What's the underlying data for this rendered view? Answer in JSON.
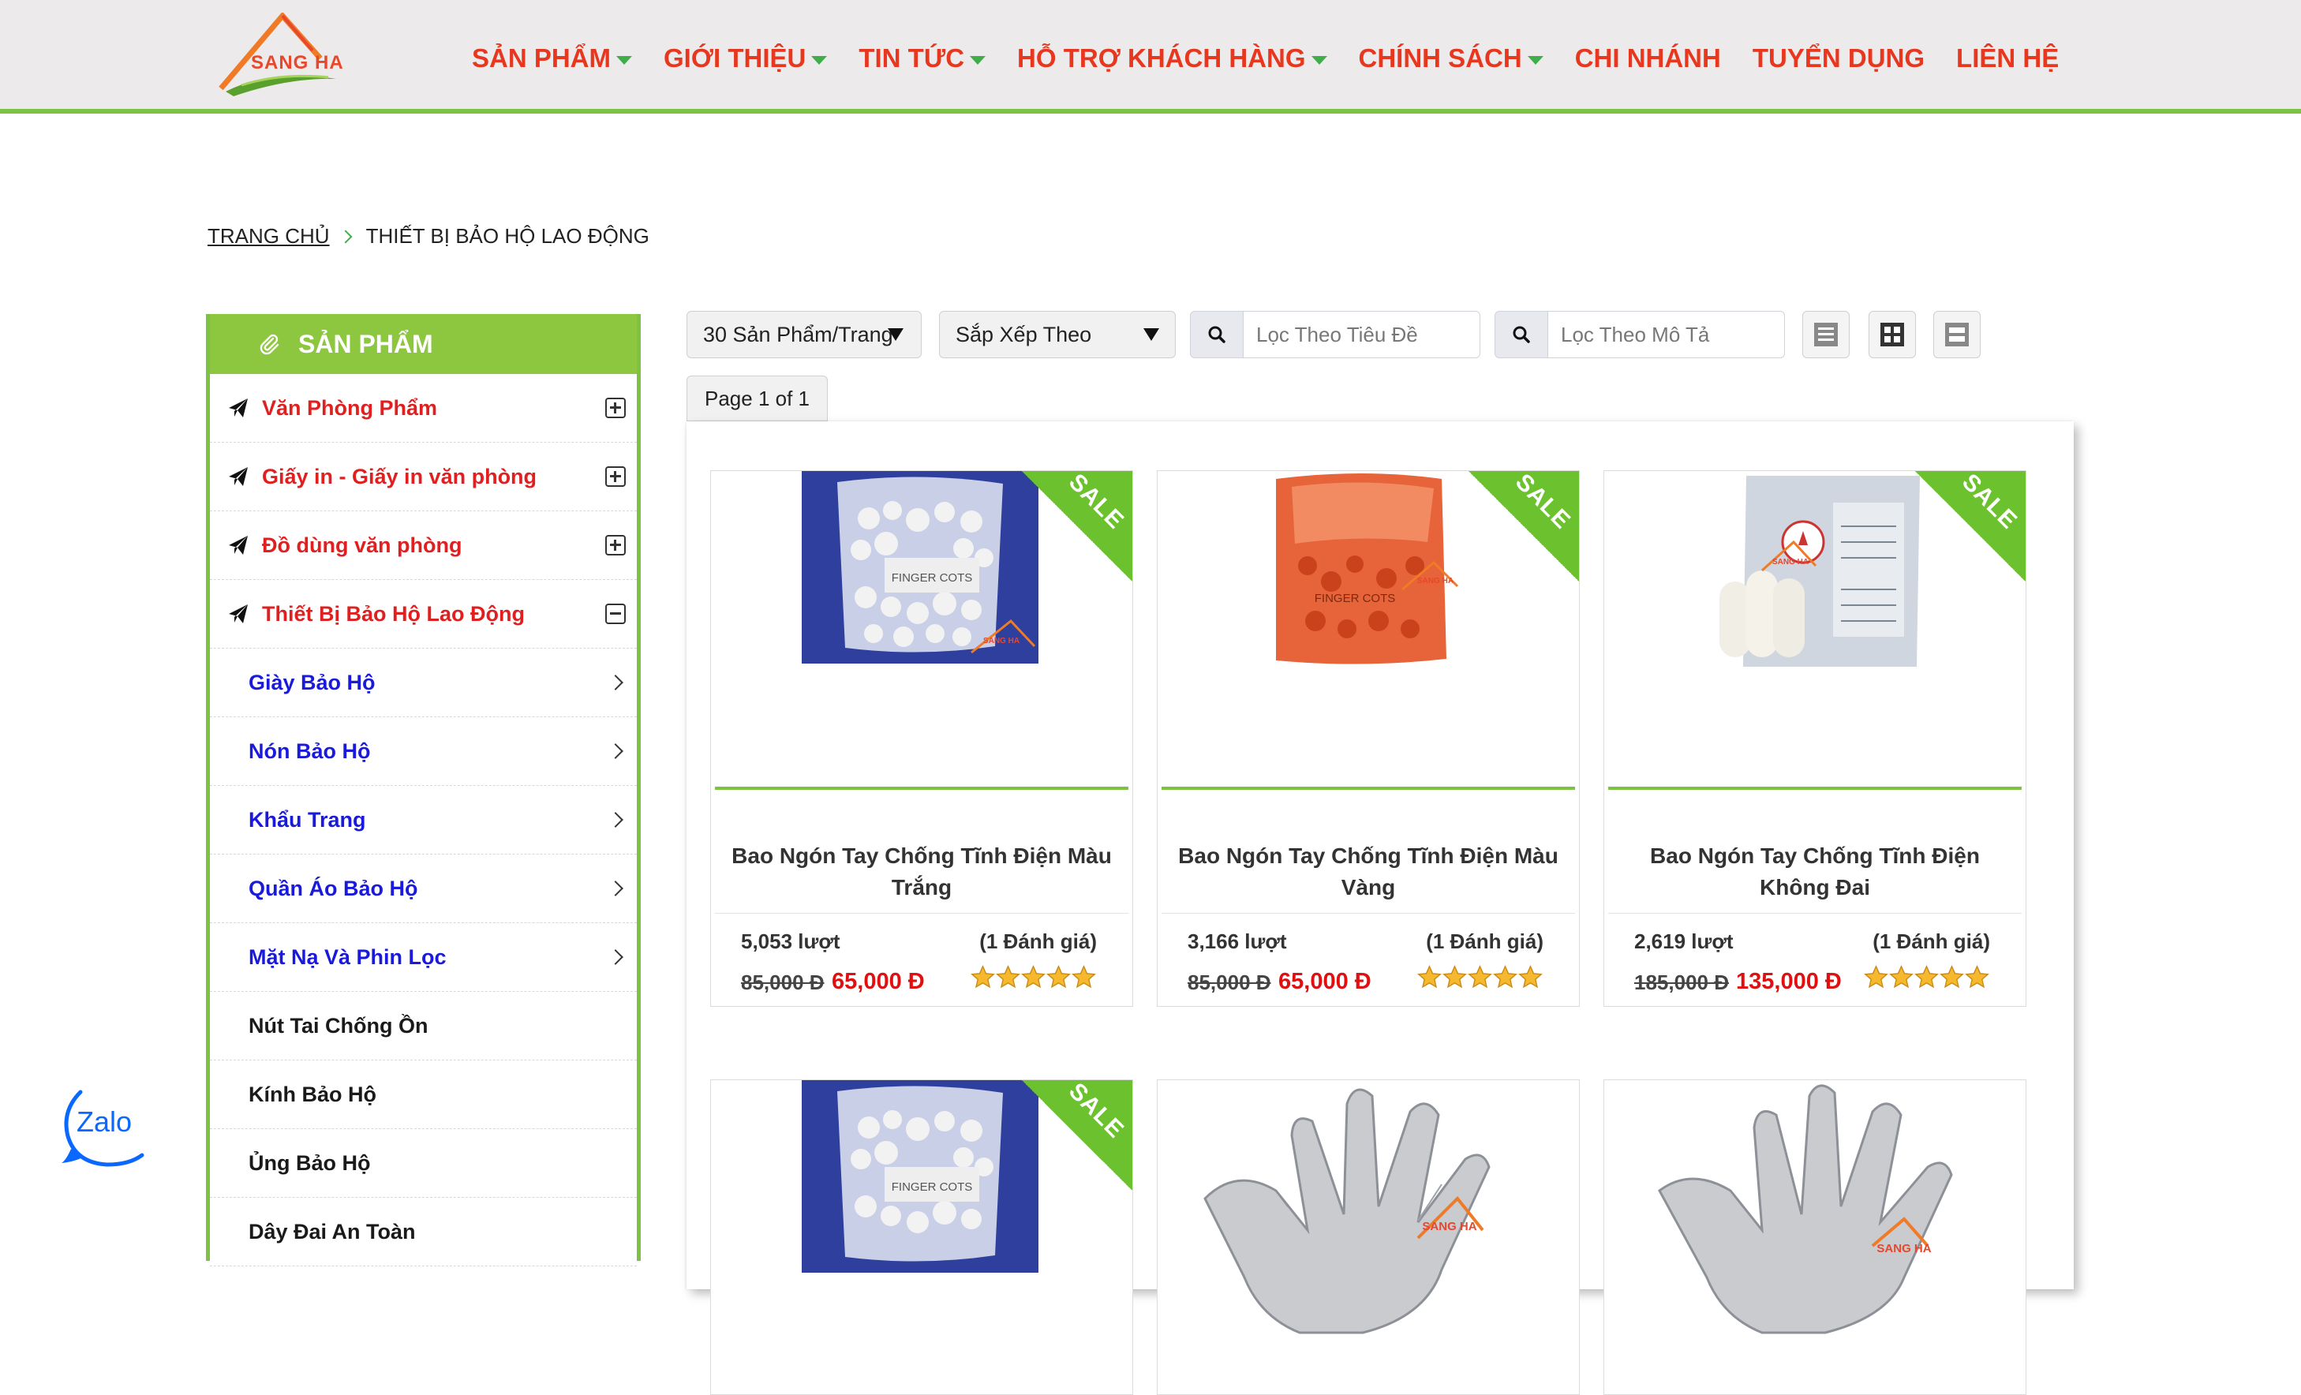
{
  "header": {
    "logo_text": "SANG HA",
    "nav": [
      {
        "label": "SẢN PHẨM",
        "dropdown": true
      },
      {
        "label": "GIỚI THIỆU",
        "dropdown": true
      },
      {
        "label": "TIN TỨC",
        "dropdown": true
      },
      {
        "label": "HỖ TRỢ KHÁCH HÀNG",
        "dropdown": true
      },
      {
        "label": "CHÍNH SÁCH",
        "dropdown": true
      },
      {
        "label": "CHI NHÁNH",
        "dropdown": false
      },
      {
        "label": "TUYỂN DỤNG",
        "dropdown": false
      },
      {
        "label": "LIÊN HỆ",
        "dropdown": false
      }
    ]
  },
  "breadcrumb": {
    "home": "TRANG CHỦ",
    "current": "THIẾT BỊ BẢO HỘ LAO ĐỘNG"
  },
  "sidebar": {
    "title": "SẢN PHẨM",
    "top_items": [
      {
        "label": "Văn Phòng Phẩm",
        "expanded": false
      },
      {
        "label": "Giấy in - Giấy in văn phòng",
        "expanded": false
      },
      {
        "label": "Đồ dùng văn phòng",
        "expanded": false
      },
      {
        "label": "Thiết Bị Bảo Hộ Lao Động",
        "expanded": true
      }
    ],
    "sub_items": [
      {
        "label": "Giày Bảo Hộ"
      },
      {
        "label": "Nón Bảo Hộ"
      },
      {
        "label": "Khẩu Trang"
      },
      {
        "label": "Quần Áo Bảo Hộ"
      },
      {
        "label": "Mặt Nạ Và Phin Lọc"
      }
    ],
    "leaf_items": [
      {
        "label": "Nút Tai Chống Ồn"
      },
      {
        "label": "Kính Bảo Hộ"
      },
      {
        "label": "Ủng Bảo Hộ"
      },
      {
        "label": "Dây Đai An Toàn"
      }
    ]
  },
  "toolbar": {
    "per_page": "30 Sản Phẩm/Trang",
    "sort": "Sắp Xếp Theo",
    "filter_title_placeholder": "Lọc Theo Tiêu Đề",
    "filter_desc_placeholder": "Lọc Theo Mô Tả",
    "page_info": "Page 1 of 1"
  },
  "products": [
    {
      "name": "Bao Ngón Tay Chống Tĩnh Điện Màu Trắng",
      "views": "5,053 lượt",
      "rating": "(1 Đánh giá)",
      "old_price": "85,000 Đ",
      "new_price": "65,000 Đ",
      "sale": "SALE",
      "stars": 5,
      "image": "white-finger-cots-bag"
    },
    {
      "name": "Bao Ngón Tay Chống Tĩnh Điện Màu Vàng",
      "views": "3,166 lượt",
      "rating": "(1 Đánh giá)",
      "old_price": "85,000 Đ",
      "new_price": "65,000 Đ",
      "sale": "SALE",
      "stars": 5,
      "image": "orange-finger-cots-bag"
    },
    {
      "name": "Bao Ngón Tay Chống Tĩnh Điện Không Đai",
      "views": "2,619 lượt",
      "rating": "(1 Đánh giá)",
      "old_price": "185,000 Đ",
      "new_price": "135,000 Đ",
      "sale": "SALE",
      "stars": 5,
      "image": "finger-cots-package"
    },
    {
      "name": "",
      "sale": "SALE",
      "image": "white-finger-cots-bag"
    },
    {
      "name": "",
      "image": "grey-antistatic-glove"
    },
    {
      "name": "",
      "image": "grey-antistatic-glove"
    }
  ],
  "watermark": "SANG HA",
  "finger_cots_print": "FINGER COTS",
  "zalo": {
    "label": "Zalo"
  },
  "colors": {
    "accent_green": "#7dc242",
    "nav_red": "#e8371f",
    "price_red": "#e01010",
    "sub_link_blue": "#1a1adc"
  }
}
